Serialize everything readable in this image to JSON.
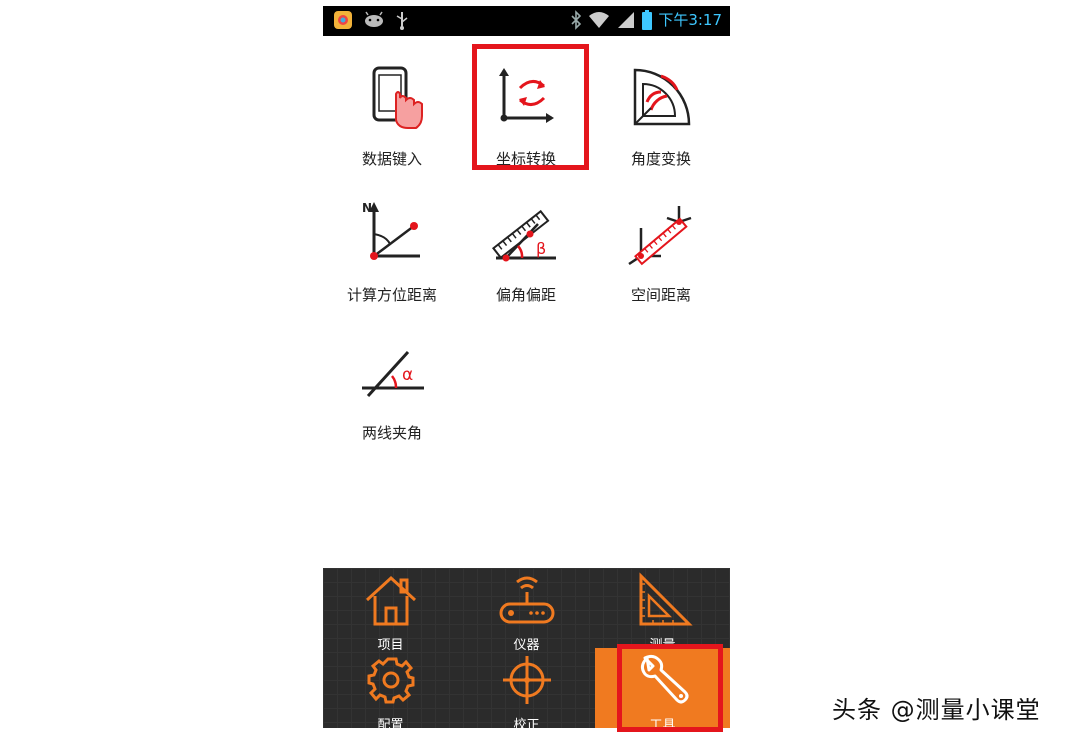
{
  "status_bar": {
    "time": "下午3:17",
    "left_icons": [
      "browser-app-icon",
      "android-icon",
      "usb-icon"
    ],
    "right_icons": [
      "bluetooth-icon",
      "wifi-icon",
      "signal-icon",
      "battery-icon"
    ]
  },
  "tools": [
    {
      "label": "数据键入",
      "icon": "touch-phone-icon",
      "highlighted": false
    },
    {
      "label": "坐标转换",
      "icon": "coordinate-convert-icon",
      "highlighted": true
    },
    {
      "label": "角度变换",
      "icon": "protractor-icon",
      "highlighted": false
    },
    {
      "label": "计算方位距离",
      "icon": "azimuth-distance-icon",
      "highlighted": false
    },
    {
      "label": "偏角偏距",
      "icon": "angle-offset-icon",
      "highlighted": false
    },
    {
      "label": "空间距离",
      "icon": "spatial-distance-icon",
      "highlighted": false
    },
    {
      "label": "两线夹角",
      "icon": "line-angle-icon",
      "highlighted": false
    }
  ],
  "bottom_nav": [
    {
      "label": "项目",
      "icon": "home-icon",
      "active": false
    },
    {
      "label": "仪器",
      "icon": "router-icon",
      "active": false
    },
    {
      "label": "测量",
      "icon": "set-square-icon",
      "active": false
    },
    {
      "label": "配置",
      "icon": "gear-icon",
      "active": false
    },
    {
      "label": "校正",
      "icon": "crosshair-icon",
      "active": false
    },
    {
      "label": "工具",
      "icon": "wrench-icon",
      "active": true
    }
  ],
  "watermark": "头条 @测量小课堂",
  "colors": {
    "accent": "#f07a20",
    "highlight": "#e4151c",
    "nav_bg": "#2b2b2b",
    "status_text": "#3ec7ff"
  }
}
